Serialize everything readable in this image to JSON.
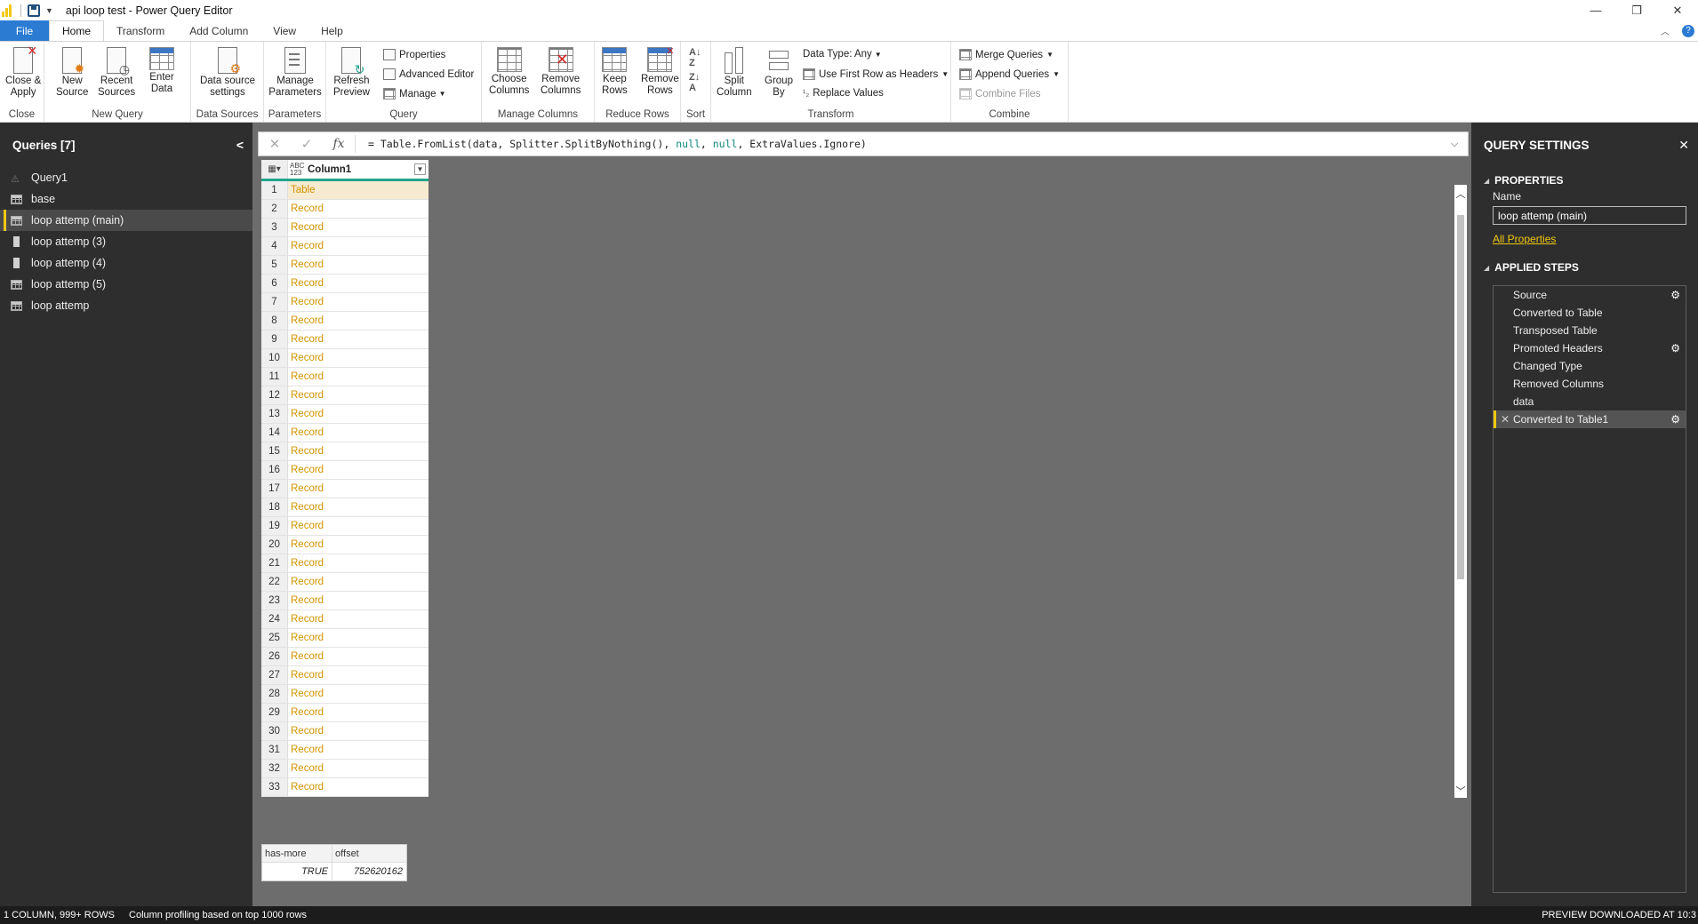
{
  "window": {
    "title": "api loop test - Power Query Editor",
    "minimize": "—",
    "restore": "❐",
    "close": "✕"
  },
  "tabs": [
    {
      "label": "File"
    },
    {
      "label": "Home"
    },
    {
      "label": "Transform"
    },
    {
      "label": "Add Column"
    },
    {
      "label": "View"
    },
    {
      "label": "Help"
    }
  ],
  "ribbon": {
    "close_group": {
      "label": "Close",
      "close_apply": "Close &\nApply"
    },
    "new_query_group": {
      "label": "New Query",
      "new_source": "New\nSource",
      "recent_sources": "Recent\nSources",
      "enter_data": "Enter\nData"
    },
    "data_sources_group": {
      "label": "Data Sources",
      "data_source_settings": "Data source\nsettings"
    },
    "parameters_group": {
      "label": "Parameters",
      "manage_parameters": "Manage\nParameters"
    },
    "query_group": {
      "label": "Query",
      "refresh_preview": "Refresh\nPreview",
      "properties": "Properties",
      "advanced_editor": "Advanced Editor",
      "manage": "Manage"
    },
    "manage_columns_group": {
      "label": "Manage Columns",
      "choose_columns": "Choose\nColumns",
      "remove_columns": "Remove\nColumns"
    },
    "reduce_rows_group": {
      "label": "Reduce Rows",
      "keep_rows": "Keep\nRows",
      "remove_rows": "Remove\nRows"
    },
    "sort_group": {
      "label": "Sort"
    },
    "transform_group": {
      "label": "Transform",
      "split_column": "Split\nColumn",
      "group_by": "Group\nBy",
      "data_type": "Data Type: Any",
      "use_first_row": "Use First Row as Headers",
      "replace_values": "Replace Values"
    },
    "combine_group": {
      "label": "Combine",
      "merge_queries": "Merge Queries",
      "append_queries": "Append Queries",
      "combine_files": "Combine Files"
    }
  },
  "queries": {
    "header": "Queries [7]",
    "items": [
      {
        "label": "Query1",
        "icon": "query-icon"
      },
      {
        "label": "base",
        "icon": "table-icon"
      },
      {
        "label": "loop attemp (main)",
        "icon": "table-icon",
        "selected": true
      },
      {
        "label": "loop attemp (3)",
        "icon": "list-icon"
      },
      {
        "label": "loop attemp (4)",
        "icon": "list-icon"
      },
      {
        "label": "loop attemp (5)",
        "icon": "table-icon"
      },
      {
        "label": "loop attemp",
        "icon": "table-icon"
      }
    ]
  },
  "formula": {
    "prefix": "= Table.FromList(data, Splitter.SplitByNothing(), ",
    "null1": "null",
    "comma": ", ",
    "null2": "null",
    "suffix": ", ExtraValues.Ignore)"
  },
  "grid": {
    "type_icon_top": "ABC",
    "type_icon_bottom": "123",
    "column_header": "Column1",
    "rows": [
      {
        "n": "1",
        "v": "Table"
      },
      {
        "n": "2",
        "v": "Record"
      },
      {
        "n": "3",
        "v": "Record"
      },
      {
        "n": "4",
        "v": "Record"
      },
      {
        "n": "5",
        "v": "Record"
      },
      {
        "n": "6",
        "v": "Record"
      },
      {
        "n": "7",
        "v": "Record"
      },
      {
        "n": "8",
        "v": "Record"
      },
      {
        "n": "9",
        "v": "Record"
      },
      {
        "n": "10",
        "v": "Record"
      },
      {
        "n": "11",
        "v": "Record"
      },
      {
        "n": "12",
        "v": "Record"
      },
      {
        "n": "13",
        "v": "Record"
      },
      {
        "n": "14",
        "v": "Record"
      },
      {
        "n": "15",
        "v": "Record"
      },
      {
        "n": "16",
        "v": "Record"
      },
      {
        "n": "17",
        "v": "Record"
      },
      {
        "n": "18",
        "v": "Record"
      },
      {
        "n": "19",
        "v": "Record"
      },
      {
        "n": "20",
        "v": "Record"
      },
      {
        "n": "21",
        "v": "Record"
      },
      {
        "n": "22",
        "v": "Record"
      },
      {
        "n": "23",
        "v": "Record"
      },
      {
        "n": "24",
        "v": "Record"
      },
      {
        "n": "25",
        "v": "Record"
      },
      {
        "n": "26",
        "v": "Record"
      },
      {
        "n": "27",
        "v": "Record"
      },
      {
        "n": "28",
        "v": "Record"
      },
      {
        "n": "29",
        "v": "Record"
      },
      {
        "n": "30",
        "v": "Record"
      },
      {
        "n": "31",
        "v": "Record"
      },
      {
        "n": "32",
        "v": "Record"
      },
      {
        "n": "33",
        "v": "Record"
      }
    ]
  },
  "detail": {
    "headers": [
      "has-more",
      "offset"
    ],
    "values": [
      "TRUE",
      "752620162"
    ]
  },
  "settings": {
    "header": "QUERY SETTINGS",
    "properties_title": "PROPERTIES",
    "name_label": "Name",
    "name_value": "loop attemp (main)",
    "all_properties": "All Properties",
    "steps_title": "APPLIED STEPS",
    "steps": [
      {
        "label": "Source",
        "gear": true
      },
      {
        "label": "Converted to Table",
        "gear": false
      },
      {
        "label": "Transposed Table",
        "gear": false
      },
      {
        "label": "Promoted Headers",
        "gear": true
      },
      {
        "label": "Changed Type",
        "gear": false
      },
      {
        "label": "Removed Columns",
        "gear": false
      },
      {
        "label": "data",
        "gear": false
      },
      {
        "label": "Converted to Table1",
        "gear": true,
        "selected": true
      }
    ]
  },
  "status": {
    "left": "1 COLUMN, 999+ ROWS",
    "middle": "Column profiling based on top 1000 rows",
    "right": "PREVIEW DOWNLOADED AT 10:3"
  },
  "colors": {
    "accent_yellow": "#f2c811",
    "file_tab": "#2b7bd3",
    "header_underline": "#20a58c",
    "value_text": "#d19400"
  }
}
